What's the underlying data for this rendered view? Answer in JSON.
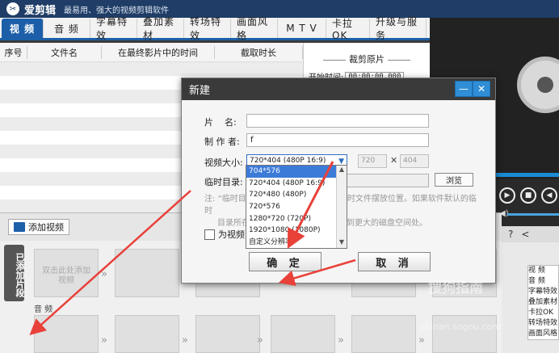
{
  "app": {
    "name": "爱剪辑",
    "slogan": "最易用、强大的视频剪辑软件"
  },
  "tabs": [
    "视 频",
    "音 频",
    "字幕特效",
    "叠加素材",
    "转场特效",
    "画面风格",
    "M T V",
    "卡拉OK",
    "升级与服务"
  ],
  "list_headers": [
    "序号",
    "文件名",
    "在最终影片中的时间",
    "截取时长"
  ],
  "crop_panel": {
    "title": "裁剪原片",
    "start_label": "开始时间:",
    "start_value": "00:00:00.000"
  },
  "add_video_label": "添加视频",
  "timeline": {
    "vertical_tab": "已添加片段",
    "audio_label": "音 频",
    "first_thumb_text": "双击此处添加视频"
  },
  "side_list": [
    "视 频",
    "音 频",
    "字幕特效",
    "叠加素材",
    "卡拉OK",
    "转场特效",
    "画面风格"
  ],
  "dialog": {
    "title": "新建",
    "name_label": "片    名:",
    "name_value": "",
    "author_label": "制 作 者:",
    "author_value": "f",
    "size_label": "视频大小:",
    "size_value": "720*404 (480P 16:9)",
    "width_value": "720",
    "height_value": "404",
    "temp_label": "临时目录:",
    "browse_label": "浏览",
    "note_line1": "注: “临时目录”用于存放软件运行时的临时文件摆放位置。如果软件默认的临时",
    "note_line2": "目录所在磁盘空间不足，建议您设定到更大的磁盘空间处。",
    "checkbox_label": "为视频自动加",
    "ok_label": "确 定",
    "cancel_label": "取 消",
    "size_options": [
      "704*576",
      "720*404 (480P 16:9)",
      "720*480 (480P)",
      "720*576",
      "1280*720 (720P)",
      "1920*1080 (1080P)",
      "自定义分辨率"
    ],
    "selected_option_index": 0
  },
  "watermark": {
    "main": "搜狗指南",
    "sub": "zhinan.sogou.com"
  },
  "colors": {
    "title_bar": "#1f3d66",
    "active_tab": "#1c5fa8",
    "dropdown_selection": "#3d7bd9",
    "annotation_arrow": "#e8413a"
  }
}
